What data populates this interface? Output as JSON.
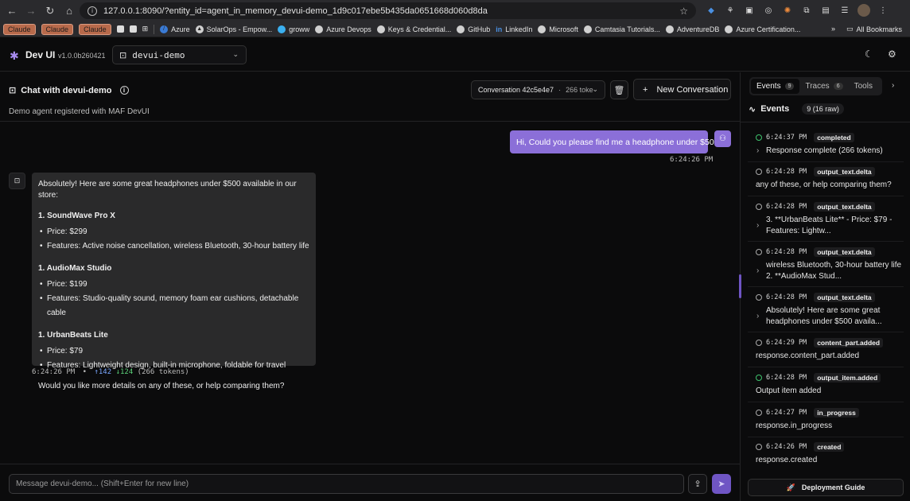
{
  "browser": {
    "url": "127.0.0.1:8090/?entity_id=agent_in_memory_devui-demo_1d9c017ebe5b435da0651668d060d8da",
    "bookmarks": [
      {
        "label": "Claude",
        "kind": "claude"
      },
      {
        "label": "Claude",
        "kind": "claude"
      },
      {
        "label": "Claude",
        "kind": "claude"
      },
      {
        "label": "Azure",
        "kind": "link"
      },
      {
        "label": "SolarOps - Empow...",
        "kind": "link"
      },
      {
        "label": "groww",
        "kind": "link"
      },
      {
        "label": "Azure Devops",
        "kind": "link"
      },
      {
        "label": "Keys & Credential...",
        "kind": "link"
      },
      {
        "label": "GitHub",
        "kind": "link"
      },
      {
        "label": "LinkedIn",
        "kind": "link"
      },
      {
        "label": "Microsoft",
        "kind": "link"
      },
      {
        "label": "Camtasia Tutorials...",
        "kind": "link"
      },
      {
        "label": "AdventureDB",
        "kind": "link"
      },
      {
        "label": "Azure Certification...",
        "kind": "link"
      }
    ],
    "more_label": "»",
    "all_bookmarks": "All Bookmarks"
  },
  "app": {
    "title": "Dev UI",
    "version": "v1.0.0b260421",
    "entity": "devui-demo"
  },
  "chat": {
    "title": "Chat with devui-demo",
    "subtitle": "Demo agent registered with MAF DevUI",
    "conversation_label": "Conversation 42c5e4e7",
    "conversation_tokens": "266 toke",
    "new_conversation": "New Conversation",
    "user_message": "Hi, Could you please find me a headphone under $500",
    "user_time": "6:24:26 PM",
    "bot": {
      "intro": "Absolutely! Here are some great headphones under $500 available in our store:",
      "products": [
        {
          "name": "1. SoundWave Pro X",
          "price": "Price: $299",
          "features": "Features: Active noise cancellation, wireless Bluetooth, 30-hour battery life"
        },
        {
          "name": "1. AudioMax Studio",
          "price": "Price: $199",
          "features": "Features: Studio-quality sound, memory foam ear cushions, detachable cable"
        },
        {
          "name": "1. UrbanBeats Lite",
          "price": "Price: $79",
          "features": "Features: Lightweight design, built-in microphone, foldable for travel"
        }
      ],
      "outro": "Would you like more details on any of these, or help comparing them?",
      "time": "6:24:26 PM",
      "dot": "•",
      "tokens_in": "↑142",
      "tokens_out": "↓124",
      "tokens_total": "(266 tokens)"
    },
    "input_placeholder": "Message devui-demo... (Shift+Enter for new line)"
  },
  "panel": {
    "tabs": [
      {
        "label": "Events",
        "count": "9",
        "active": true
      },
      {
        "label": "Traces",
        "count": "6",
        "active": false
      },
      {
        "label": "Tools",
        "count": "",
        "active": false
      }
    ],
    "events_title": "Events",
    "events_count": "9 (16 raw)",
    "events": [
      {
        "time": "6:24:37 PM",
        "type": "completed",
        "status": "ok",
        "body": "Response complete (266 tokens)",
        "expand": true
      },
      {
        "time": "6:24:28 PM",
        "type": "output_text.delta",
        "status": "pending",
        "body": "any of these, or help comparing them?",
        "expand": false
      },
      {
        "time": "6:24:28 PM",
        "type": "output_text.delta",
        "status": "pending",
        "body": "3. **UrbanBeats Lite** - Price: $79 - Features: Lightw...",
        "expand": true
      },
      {
        "time": "6:24:28 PM",
        "type": "output_text.delta",
        "status": "pending",
        "body": "wireless Bluetooth, 30-hour battery life 2. **AudioMax Stud...",
        "expand": true
      },
      {
        "time": "6:24:28 PM",
        "type": "output_text.delta",
        "status": "pending",
        "body": "Absolutely! Here are some great headphones under $500 availa...",
        "expand": true
      },
      {
        "time": "6:24:29 PM",
        "type": "content_part.added",
        "status": "pending",
        "body": "response.content_part.added",
        "expand": false
      },
      {
        "time": "6:24:28 PM",
        "type": "output_item.added",
        "status": "ok",
        "body": "Output item added",
        "expand": false
      },
      {
        "time": "6:24:27 PM",
        "type": "in_progress",
        "status": "pending",
        "body": "response.in_progress",
        "expand": false
      },
      {
        "time": "6:24:26 PM",
        "type": "created",
        "status": "pending",
        "body": "response.created",
        "expand": false
      }
    ],
    "deploy_label": "Deployment Guide"
  },
  "colors": {
    "accent": "#8b6fd8",
    "success": "#3ec46d",
    "background": "#0b0b0c"
  }
}
